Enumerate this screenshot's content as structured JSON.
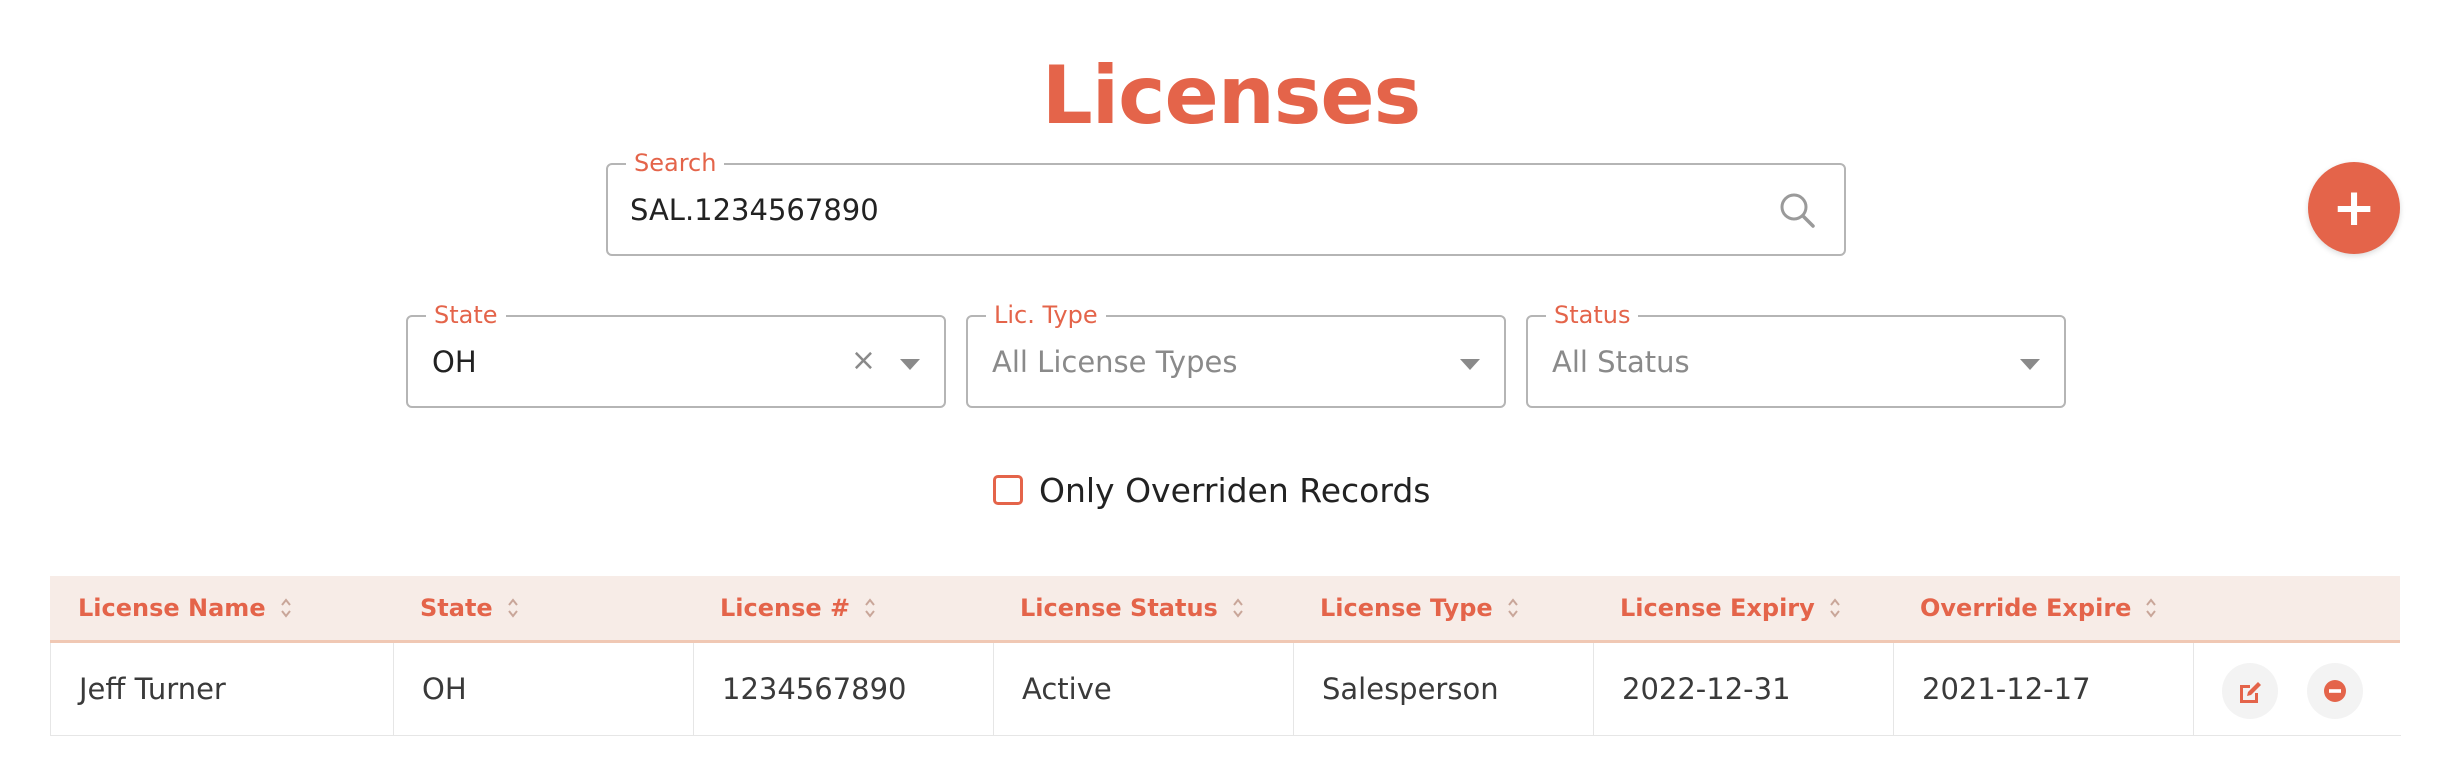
{
  "page": {
    "title": "Licenses"
  },
  "search": {
    "label": "Search",
    "value": "SAL.1234567890",
    "icon": "search-icon"
  },
  "filters": {
    "state": {
      "label": "State",
      "value": "OH",
      "clear": "×"
    },
    "lic_type": {
      "label": "Lic. Type",
      "value": "All License Types"
    },
    "status": {
      "label": "Status",
      "value": "All Status"
    }
  },
  "add_button": {
    "label": "+"
  },
  "override_checkbox": {
    "label": "Only Overriden Records",
    "checked": false
  },
  "table": {
    "columns": [
      "License Name",
      "State",
      "License #",
      "License Status",
      "License Type",
      "License Expiry",
      "Override Expire"
    ],
    "rows": [
      {
        "license_name": "Jeff Turner",
        "state": "OH",
        "license_number": "1234567890",
        "license_status": "Active",
        "license_type": "Salesperson",
        "license_expiry": "2022-12-31",
        "override_expire": "2021-12-17"
      }
    ]
  },
  "colors": {
    "accent": "#e4644a",
    "header_bg": "#f7ece7",
    "border": "#b5b5b5"
  }
}
